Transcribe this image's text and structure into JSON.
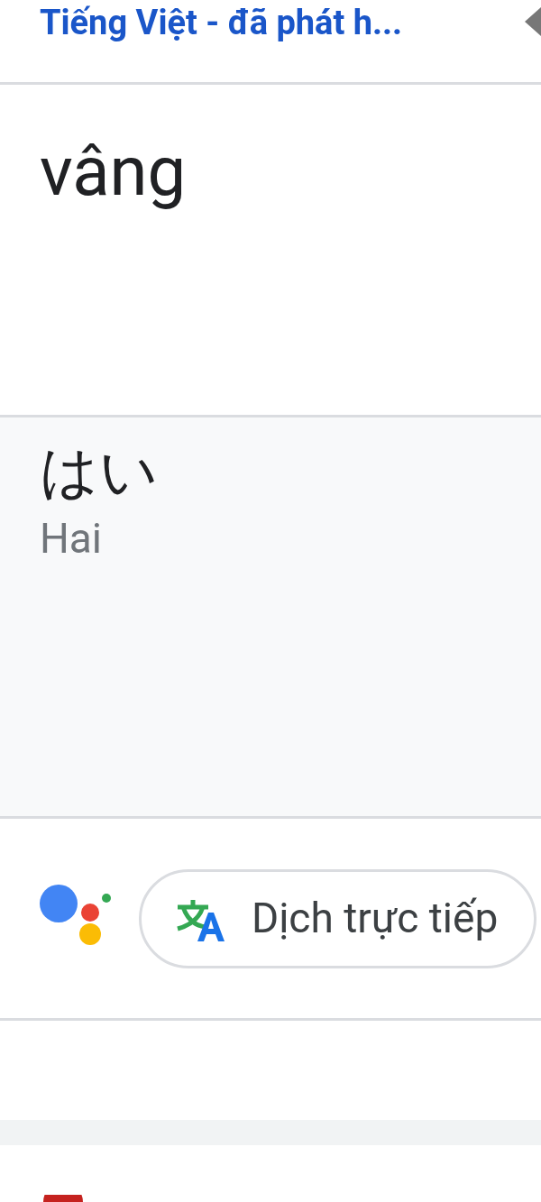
{
  "header": {
    "title": "Tiếng Việt - đã phát h..."
  },
  "source": {
    "text": "vâng"
  },
  "result": {
    "text": "はい",
    "romanization": "Hai"
  },
  "assistant": {
    "chip": "Dịch trực tiếp"
  }
}
